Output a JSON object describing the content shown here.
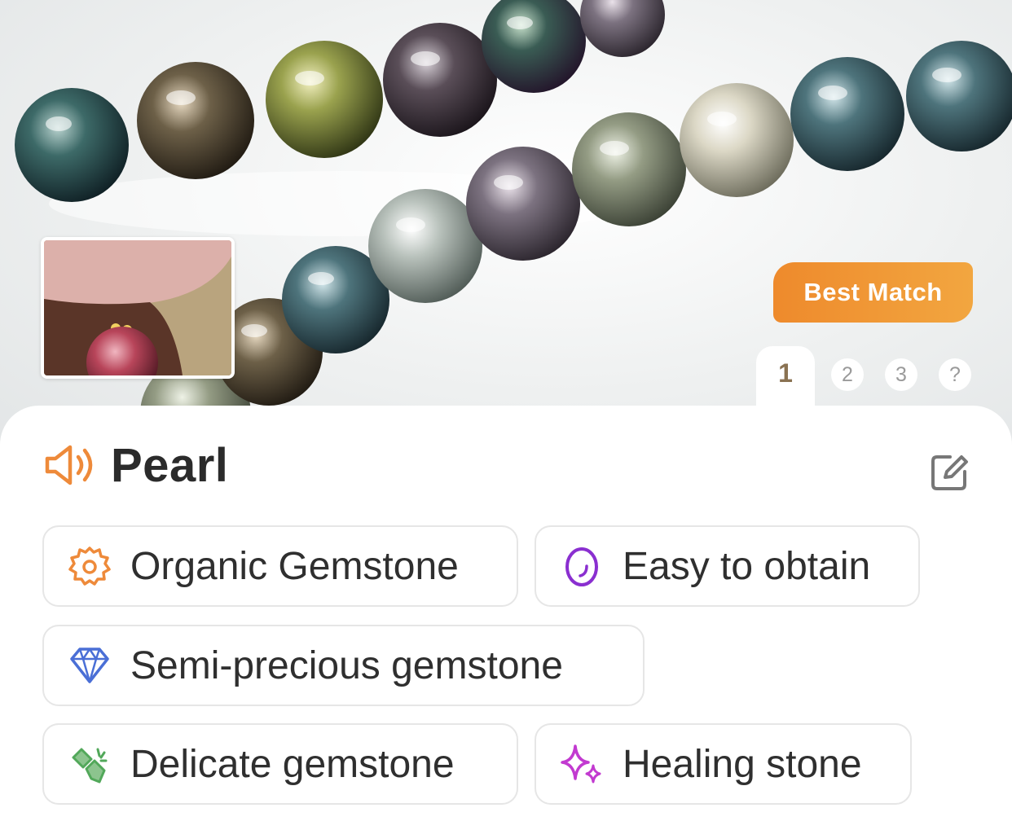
{
  "hero": {
    "badge_label": "Best Match",
    "pages": [
      "1",
      "2",
      "3",
      "?"
    ],
    "active_page": "1"
  },
  "result": {
    "title": "Pearl"
  },
  "tags": [
    {
      "label": "Organic Gemstone",
      "icon": "oyster-pearl-icon",
      "color": "#ee8a3a"
    },
    {
      "label": "Easy to obtain",
      "icon": "oval-gem-icon",
      "color": "#8a2fd0"
    },
    {
      "label": "Semi-precious gemstone",
      "icon": "diamond-icon",
      "color": "#4a6fd6"
    },
    {
      "label": "Delicate gemstone",
      "icon": "broken-crystal-icon",
      "color": "#52a85a"
    },
    {
      "label": "Healing stone",
      "icon": "sparkles-icon",
      "color": "#c23ad0"
    }
  ]
}
